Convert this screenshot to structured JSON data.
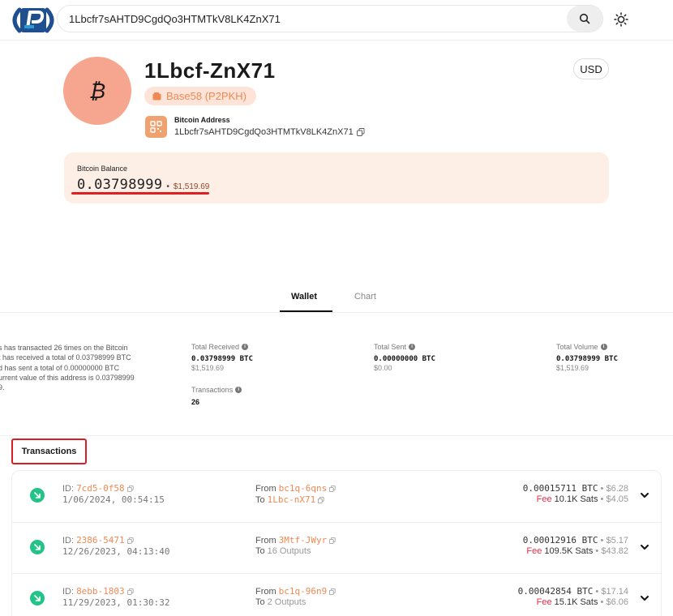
{
  "header": {
    "search_value": "1Lbcfr7sAHTD9CgdQo3HTMTkV8LK4ZnX71",
    "search_icon": "search-icon",
    "theme_icon": "sun-icon"
  },
  "profile": {
    "title": "1Lbcf-ZnX71",
    "type_badge": "Base58 (P2PKH)",
    "currency": "USD",
    "address_label": "Bitcoin Address",
    "address": "1Lbcfr7sAHTD9CgdQo3HTMTkV8LK4ZnX71"
  },
  "balance": {
    "label": "Bitcoin Balance",
    "btc": "0.03798999",
    "separator": "•",
    "usd": "$1,519.69"
  },
  "tabs": [
    {
      "label": "Wallet",
      "active": true
    },
    {
      "label": "Chart",
      "active": false
    }
  ],
  "summary": {
    "lines": [
      "s has transacted 26 times on the Bitcoin",
      "t has received a total of 0.03798999 BTC",
      "d has sent a total of 0.00000000 BTC",
      "urrent value of this address is 0.03798999",
      "9."
    ]
  },
  "stats": {
    "received": {
      "label": "Total Received",
      "btc": "0.03798999 BTC",
      "usd": "$1,519.69"
    },
    "sent": {
      "label": "Total Sent",
      "btc": "0.00000000 BTC",
      "usd": "$0.00"
    },
    "volume": {
      "label": "Total Volume",
      "btc": "0.03798999 BTC",
      "usd": "$1,519.69"
    },
    "transactions": {
      "label": "Transactions",
      "value": "26"
    }
  },
  "transactions_heading": "Transactions",
  "transactions": [
    {
      "id_label": "ID:",
      "id": "7cd5-0f58",
      "time": "1/06/2024, 00:54:15",
      "from_label": "From",
      "from": "bc1q-6qns",
      "to_label": "To",
      "to": "1Lbc-nX71",
      "amount_btc": "0.00015711 BTC",
      "amount_usd": "$6.28",
      "fee_label": "Fee",
      "fee_sats": "10.1K Sats",
      "fee_usd": "$4.05"
    },
    {
      "id_label": "ID:",
      "id": "2386-5471",
      "time": "12/26/2023, 04:13:40",
      "from_label": "From",
      "from": "3Mtf-JWyr",
      "to_label": "To",
      "to": "16 Outputs",
      "amount_btc": "0.00012916 BTC",
      "amount_usd": "$5.17",
      "fee_label": "Fee",
      "fee_sats": "109.5K Sats",
      "fee_usd": "$43.82"
    },
    {
      "id_label": "ID:",
      "id": "8ebb-1803",
      "time": "11/29/2023, 01:30:32",
      "from_label": "From",
      "from": "bc1q-96n9",
      "to_label": "To",
      "to": "2 Outputs",
      "amount_btc": "0.00042854 BTC",
      "amount_usd": "$17.14",
      "fee_label": "Fee",
      "fee_sats": "15.1K Sats",
      "fee_usd": "$6.06"
    }
  ],
  "colors": {
    "accent": "#ef8a55",
    "avatar_bg": "#f6a68f",
    "balance_bg": "#fdeee6",
    "incoming": "#25c28a",
    "fee": "#e0304a",
    "highlight": "#d81f26"
  }
}
